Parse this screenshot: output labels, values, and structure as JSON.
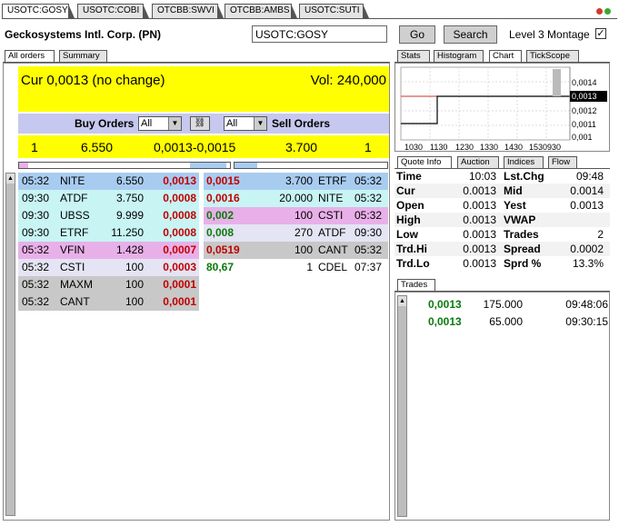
{
  "top_tabs": [
    "USOTC:GOSY",
    "USOTC:COBI",
    "OTCBB:SWVI",
    "OTCBB:AMBS",
    "USOTC:SUTI"
  ],
  "header": {
    "company": "Geckosystems Intl. Corp. (PN)",
    "symbol_value": "USOTC:GOSY",
    "go_label": "Go",
    "search_label": "Search",
    "montage_label": "Level 3 Montage",
    "montage_checked": "✓"
  },
  "left_tabs": [
    "All orders",
    "Summary"
  ],
  "quote_banner": {
    "cur": "Cur 0,0013 (no change)",
    "vol": "Vol: 240,000"
  },
  "orders_bar": {
    "buy_label": "Buy Orders",
    "sell_label": "Sell Orders",
    "buy_filter": "All",
    "sell_filter": "All"
  },
  "summary": {
    "buy_count": "1",
    "buy_size": "6.550",
    "spread": "0,0013-0,0015",
    "sell_size": "3.700",
    "sell_count": "1"
  },
  "buy_orders": [
    {
      "time": "05:32",
      "mm": "NITE",
      "size": "6.550",
      "price": "0,0013",
      "bg": "#a8ccf0"
    },
    {
      "time": "09:30",
      "mm": "ATDF",
      "size": "3.750",
      "price": "0,0008",
      "bg": "#c8f4f4"
    },
    {
      "time": "09:30",
      "mm": "UBSS",
      "size": "9.999",
      "price": "0,0008",
      "bg": "#c8f4f4"
    },
    {
      "time": "09:30",
      "mm": "ETRF",
      "size": "11.250",
      "price": "0,0008",
      "bg": "#c8f4f4"
    },
    {
      "time": "05:32",
      "mm": "VFIN",
      "size": "1.428",
      "price": "0,0007",
      "bg": "#e8b0e8"
    },
    {
      "time": "05:32",
      "mm": "CSTI",
      "size": "100",
      "price": "0,0003",
      "bg": "#e4e4f4"
    },
    {
      "time": "05:32",
      "mm": "MAXM",
      "size": "100",
      "price": "0,0001",
      "bg": "#c8c8c8"
    },
    {
      "time": "05:32",
      "mm": "CANT",
      "size": "100",
      "price": "0,0001",
      "bg": "#c8c8c8"
    }
  ],
  "sell_orders": [
    {
      "price": "0,0015",
      "size": "3.700",
      "mm": "ETRF",
      "time": "05:32",
      "bg": "#a8ccf0",
      "color": "red"
    },
    {
      "price": "0,0016",
      "size": "20.000",
      "mm": "NITE",
      "time": "05:32",
      "bg": "#c8f4f4",
      "color": "red"
    },
    {
      "price": "0,002",
      "size": "100",
      "mm": "CSTI",
      "time": "05:32",
      "bg": "#e8b0e8",
      "color": "green"
    },
    {
      "price": "0,008",
      "size": "270",
      "mm": "ATDF",
      "time": "09:30",
      "bg": "#e4e4f4",
      "color": "green"
    },
    {
      "price": "0,0519",
      "size": "100",
      "mm": "CANT",
      "time": "05:32",
      "bg": "#c8c8c8",
      "color": "red"
    },
    {
      "price": "80,67",
      "size": "1",
      "mm": "CDEL",
      "time": "07:37",
      "bg": "#ffffff",
      "color": "green"
    }
  ],
  "right_tabs_top": [
    "Stats",
    "Histogram",
    "Chart",
    "TickScope"
  ],
  "chart": {
    "y_labels": [
      "0,0014",
      "0,0013",
      "0,0012",
      "0,0011",
      "0,001"
    ],
    "x_labels": [
      "1030",
      "1130",
      "1230",
      "1330",
      "1430",
      "1530930"
    ],
    "highlight_label": "0,0013"
  },
  "right_tabs_mid": [
    "Quote Info",
    "Auction",
    "Indices",
    "Flow"
  ],
  "quote_info": [
    {
      "l1": "Time",
      "v1": "10:03",
      "l2": "Lst.Chg",
      "v2": "09:48"
    },
    {
      "l1": "Cur",
      "v1": "0.0013",
      "l2": "Mid",
      "v2": "0.0014"
    },
    {
      "l1": "Open",
      "v1": "0.0013",
      "l2": "Yest",
      "v2": "0.0013"
    },
    {
      "l1": "High",
      "v1": "0.0013",
      "l2": "VWAP",
      "v2": ""
    },
    {
      "l1": "Low",
      "v1": "0.0013",
      "l2": "Trades",
      "v2": "2"
    },
    {
      "l1": "Trd.Hi",
      "v1": "0.0013",
      "l2": "Spread",
      "v2": "0.0002"
    },
    {
      "l1": "Trd.Lo",
      "v1": "0.0013",
      "l2": "Sprd %",
      "v2": "13.3%"
    }
  ],
  "trades_tab": "Trades",
  "trades": [
    {
      "price": "0,0013",
      "size": "175.000",
      "time": "09:48:06"
    },
    {
      "price": "0,0013",
      "size": "65.000",
      "time": "09:30:15"
    }
  ],
  "colors": {
    "yellow": "#ffff00",
    "lavender": "#c6c8ef",
    "red": "#c00000",
    "green": "#0b7a0b"
  }
}
